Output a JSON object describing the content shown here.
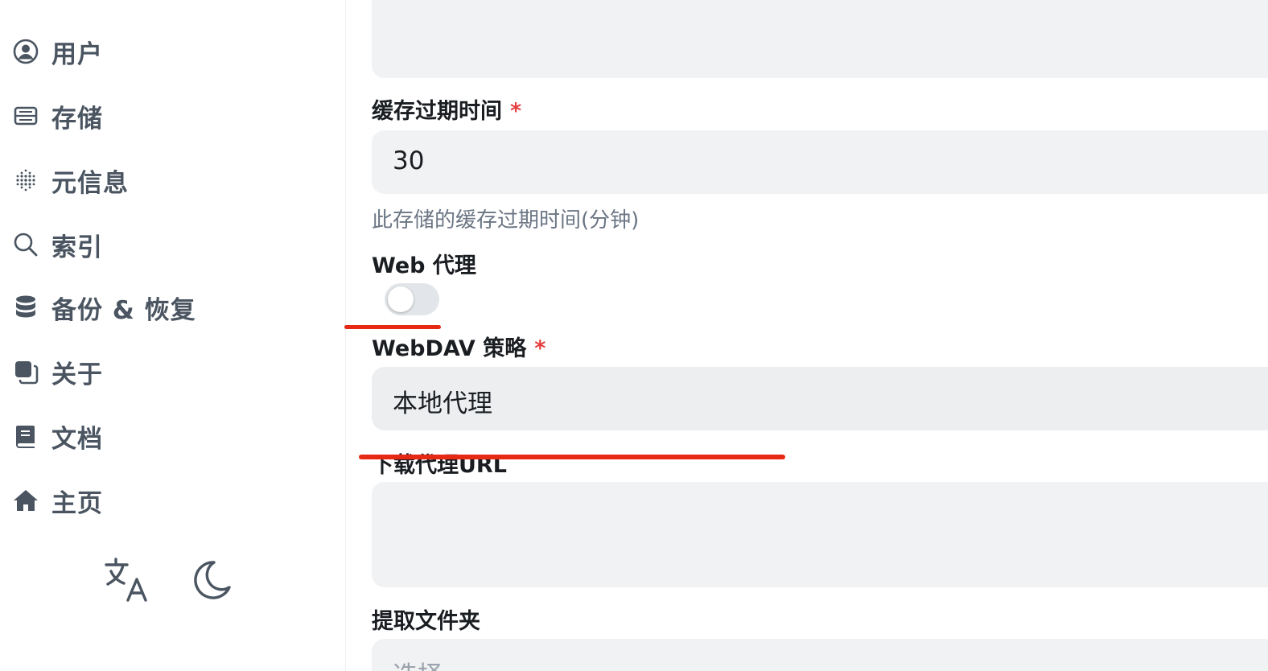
{
  "sidebar": {
    "items": [
      {
        "label": "用户",
        "icon": "user-circle-icon"
      },
      {
        "label": "存储",
        "icon": "storage-icon"
      },
      {
        "label": "元信息",
        "icon": "metadata-icon"
      },
      {
        "label": "索引",
        "icon": "search-icon"
      },
      {
        "label": "备份 & 恢复",
        "icon": "database-icon"
      },
      {
        "label": "关于",
        "icon": "about-icon"
      },
      {
        "label": "文档",
        "icon": "book-icon"
      },
      {
        "label": "主页",
        "icon": "home-icon"
      }
    ],
    "footer": {
      "translate_icon": "translate-icon",
      "theme_icon": "moon-icon"
    }
  },
  "form": {
    "cache_expiry": {
      "label": "缓存过期时间",
      "required_mark": "*",
      "value": "30",
      "help": "此存储的缓存过期时间(分钟)"
    },
    "web_proxy": {
      "label": "Web 代理",
      "enabled": false
    },
    "webdav_policy": {
      "label": "WebDAV 策略",
      "required_mark": "*",
      "value": "本地代理"
    },
    "download_proxy_url": {
      "label": "下载代理URL",
      "value": ""
    },
    "extract_folder": {
      "label": "提取文件夹",
      "placeholder": "选择"
    }
  },
  "colors": {
    "accent_required": "#e53e3e",
    "annotation": "#e62814",
    "sidebar_text": "#4a5561",
    "field_bg": "#f1f2f4"
  }
}
